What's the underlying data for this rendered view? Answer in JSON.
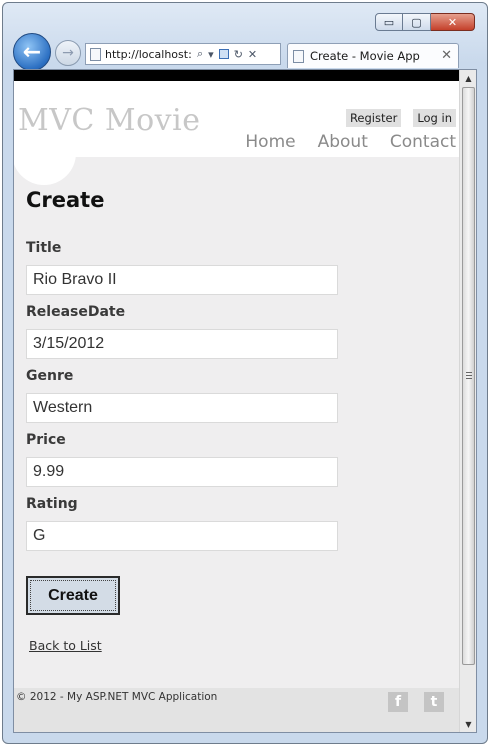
{
  "browser": {
    "address": "http://localhost:",
    "tab_title": "Create - Movie App",
    "tab_close": "✕",
    "caption": {
      "minimize": "▭",
      "maximize": "▢",
      "close": "✕"
    },
    "back_arrow": "←",
    "forward_arrow": "→",
    "addr_icons": {
      "search": "⌕",
      "dropdown": "▾",
      "refresh": "↻",
      "stop": "✕"
    }
  },
  "site": {
    "title": "MVC Movie",
    "login": {
      "register": "Register",
      "login": "Log in"
    },
    "menu": [
      "Home",
      "About",
      "Contact"
    ]
  },
  "page": {
    "heading": "Create",
    "fields": [
      {
        "label": "Title",
        "value": "Rio Bravo II"
      },
      {
        "label": "ReleaseDate",
        "value": "3/15/2012"
      },
      {
        "label": "Genre",
        "value": "Western"
      },
      {
        "label": "Price",
        "value": "9.99"
      },
      {
        "label": "Rating",
        "value": "G"
      }
    ],
    "submit_label": "Create",
    "back_link": "Back to List"
  },
  "footer": {
    "text": "© 2012 - My ASP.NET MVC Application",
    "social": {
      "facebook": "f",
      "twitter": "t"
    }
  }
}
